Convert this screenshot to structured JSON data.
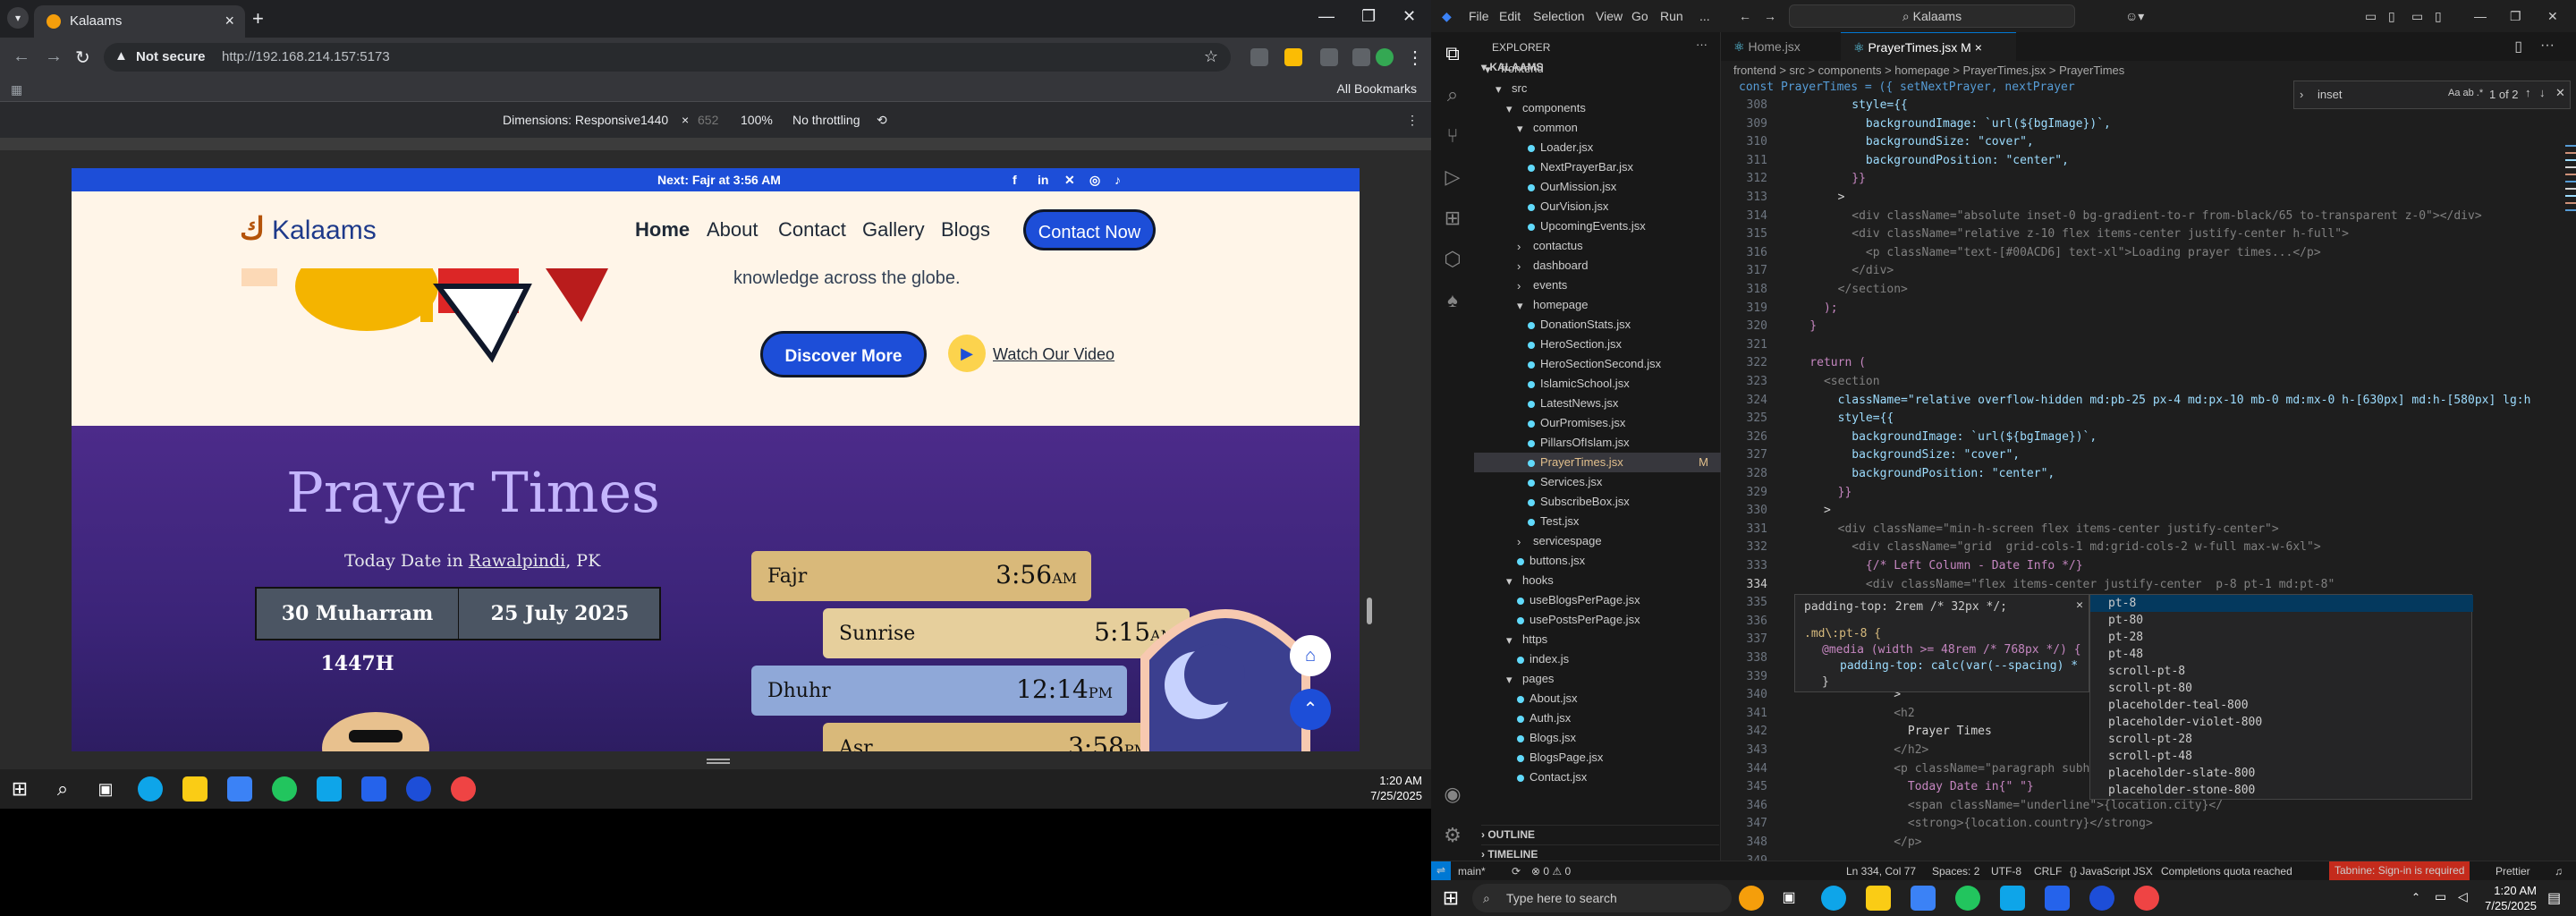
{
  "browser": {
    "tab_title": "Kalaams",
    "not_secure": "Not secure",
    "url": "http://192.168.214.157:5173",
    "all_bookmarks": "All Bookmarks",
    "devtools": {
      "dimensions_label": "Dimensions: Responsive",
      "width": "1440",
      "height": "652",
      "zoom": "100%",
      "throttle": "No throttling"
    }
  },
  "site": {
    "top_strip": "Next: Fajr at 3:56 AM",
    "logo_text": "Kalaams",
    "nav": [
      "Home",
      "About",
      "Contact",
      "Gallery",
      "Blogs"
    ],
    "cta": "Contact Now",
    "hero_fragment": "knowledge across the globe.",
    "discover": "Discover More",
    "watch": "Watch Our Video",
    "prayer_title": "Prayer Times",
    "today_prefix": "Today Date in",
    "city": "Rawalpindi",
    "country": "PK",
    "hijri": "30 Muharram 1447H",
    "gregorian": "25 July 2025",
    "prayers": [
      {
        "name": "Fajr",
        "time": "3:56",
        "ampm": "AM"
      },
      {
        "name": "Sunrise",
        "time": "5:15",
        "ampm": "AM"
      },
      {
        "name": "Dhuhr",
        "time": "12:14",
        "ampm": "PM"
      },
      {
        "name": "Asr",
        "time": "3:58",
        "ampm": "PM"
      }
    ]
  },
  "vscode": {
    "menu": [
      "File",
      "Edit",
      "Selection",
      "View",
      "Go",
      "Run",
      "..."
    ],
    "search": "Kalaams",
    "explorer_label": "EXPLORER",
    "project": "KALAAMS",
    "tree": [
      {
        "label": "frontend",
        "depth": 1,
        "type": "folder-open"
      },
      {
        "label": "src",
        "depth": 2,
        "type": "folder-open"
      },
      {
        "label": "components",
        "depth": 3,
        "type": "folder-open"
      },
      {
        "label": "common",
        "depth": 4,
        "type": "folder-open"
      },
      {
        "label": "Loader.jsx",
        "depth": 5,
        "type": "file"
      },
      {
        "label": "NextPrayerBar.jsx",
        "depth": 5,
        "type": "file"
      },
      {
        "label": "OurMission.jsx",
        "depth": 5,
        "type": "file"
      },
      {
        "label": "OurVision.jsx",
        "depth": 5,
        "type": "file"
      },
      {
        "label": "UpcomingEvents.jsx",
        "depth": 5,
        "type": "file"
      },
      {
        "label": "contactus",
        "depth": 4,
        "type": "folder"
      },
      {
        "label": "dashboard",
        "depth": 4,
        "type": "folder"
      },
      {
        "label": "events",
        "depth": 4,
        "type": "folder"
      },
      {
        "label": "homepage",
        "depth": 4,
        "type": "folder-open"
      },
      {
        "label": "DonationStats.jsx",
        "depth": 5,
        "type": "file"
      },
      {
        "label": "HeroSection.jsx",
        "depth": 5,
        "type": "file"
      },
      {
        "label": "HeroSectionSecond.jsx",
        "depth": 5,
        "type": "file"
      },
      {
        "label": "IslamicSchool.jsx",
        "depth": 5,
        "type": "file"
      },
      {
        "label": "LatestNews.jsx",
        "depth": 5,
        "type": "file"
      },
      {
        "label": "OurPromises.jsx",
        "depth": 5,
        "type": "file"
      },
      {
        "label": "PillarsOfIslam.jsx",
        "depth": 5,
        "type": "file"
      },
      {
        "label": "PrayerTimes.jsx",
        "depth": 5,
        "type": "file",
        "status": "M",
        "selected": true
      },
      {
        "label": "Services.jsx",
        "depth": 5,
        "type": "file"
      },
      {
        "label": "SubscribeBox.jsx",
        "depth": 5,
        "type": "file"
      },
      {
        "label": "Test.jsx",
        "depth": 5,
        "type": "file"
      },
      {
        "label": "servicespage",
        "depth": 4,
        "type": "folder"
      },
      {
        "label": "buttons.jsx",
        "depth": 4,
        "type": "file"
      },
      {
        "label": "hooks",
        "depth": 3,
        "type": "folder-open"
      },
      {
        "label": "useBlogsPerPage.jsx",
        "depth": 4,
        "type": "file"
      },
      {
        "label": "usePostsPerPage.jsx",
        "depth": 4,
        "type": "file"
      },
      {
        "label": "https",
        "depth": 3,
        "type": "folder-open"
      },
      {
        "label": "index.js",
        "depth": 4,
        "type": "file"
      },
      {
        "label": "pages",
        "depth": 3,
        "type": "folder-open"
      },
      {
        "label": "About.jsx",
        "depth": 4,
        "type": "file"
      },
      {
        "label": "Auth.jsx",
        "depth": 4,
        "type": "file"
      },
      {
        "label": "Blogs.jsx",
        "depth": 4,
        "type": "file"
      },
      {
        "label": "BlogsPage.jsx",
        "depth": 4,
        "type": "file"
      },
      {
        "label": "Contact.jsx",
        "depth": 4,
        "type": "file"
      }
    ],
    "outline": "OUTLINE",
    "timeline": "TIMELINE",
    "tabs": [
      {
        "label": "Home.jsx",
        "active": false
      },
      {
        "label": "PrayerTimes.jsx M",
        "active": true
      }
    ],
    "breadcrumb": "frontend > src > components > homepage > PrayerTimes.jsx > PrayerTimes",
    "sticky": "const PrayerTimes = ({ setNextPrayer, nextPrayer",
    "find_value": "inset",
    "find_count": "1 of 2",
    "code": [
      {
        "n": "308",
        "t": "          style={{"
      },
      {
        "n": "309",
        "t": "            backgroundImage: `url(${bgImage})`,"
      },
      {
        "n": "310",
        "t": "            backgroundSize: \"cover\","
      },
      {
        "n": "311",
        "t": "            backgroundPosition: \"center\","
      },
      {
        "n": "312",
        "t": "          }}"
      },
      {
        "n": "313",
        "t": "        >"
      },
      {
        "n": "314",
        "t": "          <div className=\"absolute inset-0 bg-gradient-to-r from-black/65 to-transparent z-0\"></div>"
      },
      {
        "n": "315",
        "t": "          <div className=\"relative z-10 flex items-center justify-center h-full\">"
      },
      {
        "n": "316",
        "t": "            <p className=\"text-[#00ACD6] text-xl\">Loading prayer times...</p>"
      },
      {
        "n": "317",
        "t": "          </div>"
      },
      {
        "n": "318",
        "t": "        </section>"
      },
      {
        "n": "319",
        "t": "      );"
      },
      {
        "n": "320",
        "t": "    }"
      },
      {
        "n": "321",
        "t": ""
      },
      {
        "n": "322",
        "t": "    return ("
      },
      {
        "n": "323",
        "t": "      <section"
      },
      {
        "n": "324",
        "t": "        className=\"relative overflow-hidden md:pb-25 px-4 md:px-10 mb-0 md:mx-0 h-[630px] md:h-[580px] lg:h"
      },
      {
        "n": "325",
        "t": "        style={{"
      },
      {
        "n": "326",
        "t": "          backgroundImage: `url(${bgImage})`,"
      },
      {
        "n": "327",
        "t": "          backgroundSize: \"cover\","
      },
      {
        "n": "328",
        "t": "          backgroundPosition: \"center\","
      },
      {
        "n": "329",
        "t": "        }}"
      },
      {
        "n": "330",
        "t": "      >"
      },
      {
        "n": "331",
        "t": "        <div className=\"min-h-screen flex items-center justify-center\">"
      },
      {
        "n": "332",
        "t": "          <div className=\"grid  grid-cols-1 md:grid-cols-2 w-full max-w-6xl\">"
      },
      {
        "n": "333",
        "t": "            {/* Left Column - Date Info */}"
      },
      {
        "n": "334",
        "t": "            <div className=\"flex items-center justify-center  p-8 pt-1 md:pt-8\""
      },
      {
        "n": "335",
        "t": "              <p cla"
      },
      {
        "n": "336",
        "t": "                <div"
      },
      {
        "n": "337",
        "t": "                  cl"
      },
      {
        "n": "338",
        "t": "                  pl"
      },
      {
        "n": "339",
        "t": "                  md"
      },
      {
        "n": "340",
        "t": "                >"
      },
      {
        "n": "341",
        "t": "                <h2"
      },
      {
        "n": "342",
        "t": "                  Prayer Times"
      },
      {
        "n": "343",
        "t": "                </h2>"
      },
      {
        "n": "344",
        "t": "                <p className=\"paragraph subheading-prayer text"
      },
      {
        "n": "345",
        "t": "                  Today Date in{\" \"}"
      },
      {
        "n": "346",
        "t": "                  <span className=\"underline\">{location.city}</"
      },
      {
        "n": "347",
        "t": "                  <strong>{location.country}</strong>"
      },
      {
        "n": "348",
        "t": "                </p>"
      },
      {
        "n": "349",
        "t": ""
      },
      {
        "n": "350",
        "t": "                <div className=\"mt-4 bg-white/80 shadow-md rounded-lg overflow-hidden w-fit\">"
      },
      {
        "n": "351",
        "t": "                  <div className=\"font-bold text-[#000000] text-xs md:text-base lg:text-base xl:text-xl"
      },
      {
        "n": "352",
        "t": "                    grid grid-cols-2 divide-x divide-black text-center\">"
      }
    ],
    "hover_doc": {
      "line1": "padding-top: 2rem /* 32px */;",
      "line2": ".md\\:pt-8 {",
      "line3": "@media (width >= 48rem /* 768px */) {",
      "line4": "padding-top: calc(var(--spacing) *",
      "line5": "}",
      "line6": "}"
    },
    "suggestions": [
      "pt-8",
      "pt-80",
      "pt-28",
      "pt-48",
      "scroll-pt-8",
      "scroll-pt-80",
      "placeholder-teal-800",
      "placeholder-violet-800",
      "scroll-pt-28",
      "scroll-pt-48",
      "placeholder-slate-800",
      "placeholder-stone-800"
    ],
    "status": {
      "branch": "main*",
      "pos": "Ln 334, Col 77",
      "spaces": "Spaces: 2",
      "enc": "UTF-8",
      "eol": "CRLF",
      "lang": "{} JavaScript JSX",
      "completions": "Completions quota reached",
      "tabnine": "Tabnine: Sign-in is required",
      "prettier": "Prettier"
    }
  },
  "taskbar": {
    "search_placeholder": "Type here to search",
    "time": "1:20 AM",
    "date": "7/25/2025"
  },
  "colors": {
    "brand_blue": "#1d4ed8",
    "prayer_bg": "#3b2478",
    "card_gold": "#d9b97a",
    "card_blue": "#8fa8d8",
    "vscode_accent": "#0078d4"
  }
}
